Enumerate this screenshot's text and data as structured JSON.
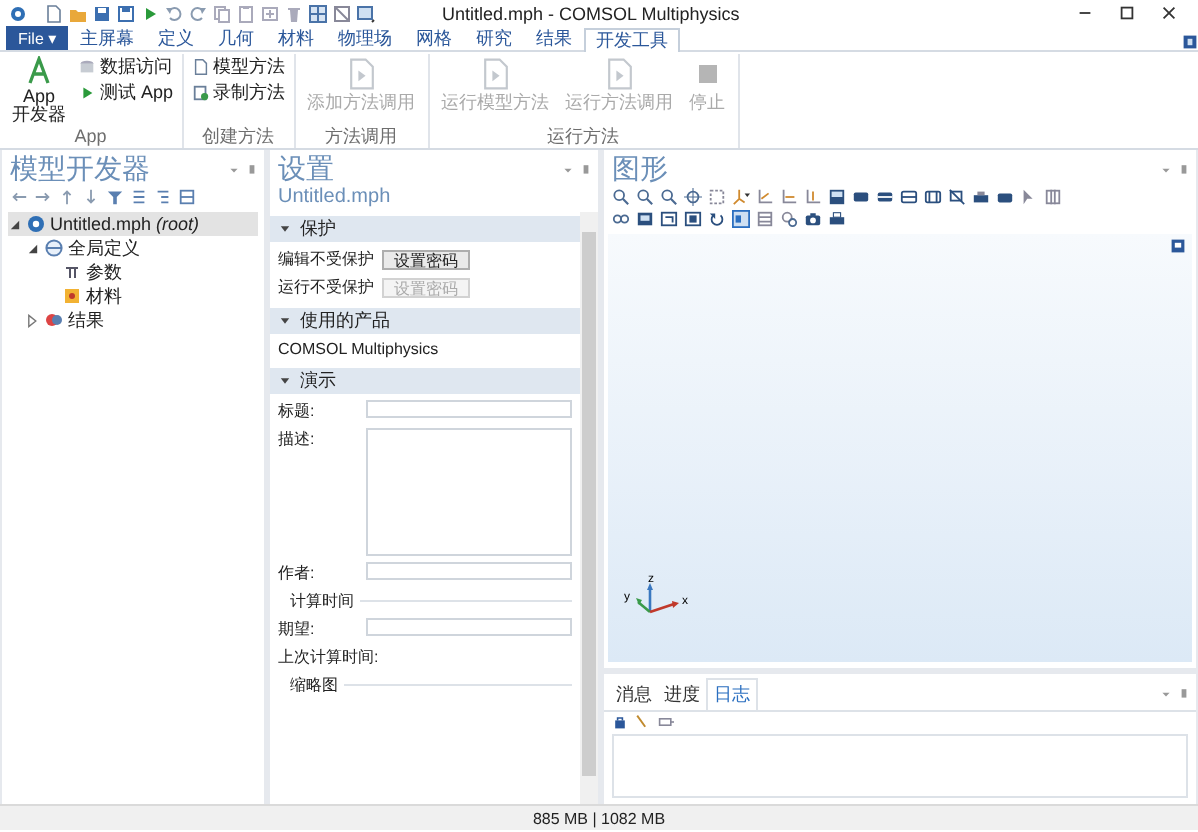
{
  "window": {
    "title": "Untitled.mph - COMSOL Multiphysics"
  },
  "ribbon_tabs": [
    {
      "label": "File ▾",
      "kind": "file",
      "selected": false
    },
    {
      "label": "主屏幕",
      "kind": "tab",
      "selected": false
    },
    {
      "label": "定义",
      "kind": "tab",
      "selected": false
    },
    {
      "label": "几何",
      "kind": "tab",
      "selected": false
    },
    {
      "label": "材料",
      "kind": "tab",
      "selected": false
    },
    {
      "label": "物理场",
      "kind": "tab",
      "selected": false
    },
    {
      "label": "网格",
      "kind": "tab",
      "selected": false
    },
    {
      "label": "研究",
      "kind": "tab",
      "selected": false
    },
    {
      "label": "结果",
      "kind": "tab",
      "selected": false
    },
    {
      "label": "开发工具",
      "kind": "tab",
      "selected": true
    }
  ],
  "ribbon_groups": [
    {
      "label": "App",
      "items": [
        {
          "kind": "large",
          "lines": [
            "App",
            "开发器"
          ],
          "disabled": false
        },
        {
          "kind": "small",
          "label": "数据访问",
          "disabled": false
        },
        {
          "kind": "small",
          "label": "测试 App",
          "disabled": false
        }
      ]
    },
    {
      "label": "创建方法",
      "items": [
        {
          "kind": "small",
          "label": "模型方法",
          "disabled": false
        },
        {
          "kind": "small",
          "label": "录制方法",
          "disabled": false
        }
      ]
    },
    {
      "label": "方法调用",
      "items": [
        {
          "kind": "large",
          "lines": [
            "添加方法调用"
          ],
          "disabled": true
        }
      ]
    },
    {
      "label": "运行方法",
      "items": [
        {
          "kind": "large",
          "lines": [
            "运行模型方法"
          ],
          "disabled": true
        },
        {
          "kind": "large",
          "lines": [
            "运行方法调用"
          ],
          "disabled": true
        },
        {
          "kind": "large",
          "lines": [
            "停止"
          ],
          "disabled": true
        }
      ]
    }
  ],
  "model_builder": {
    "title": "模型开发器",
    "tree": [
      {
        "label": "Untitled.mph *(root)*",
        "expanded": true,
        "selected": true,
        "children": [
          {
            "label": "全局定义",
            "expanded": true,
            "selected": false,
            "children": [
              {
                "label": "参数",
                "selected": false
              },
              {
                "label": "材料",
                "selected": false
              }
            ]
          },
          {
            "label": "结果",
            "expanded": false,
            "selected": false
          }
        ]
      }
    ]
  },
  "settings": {
    "title": "设置",
    "subtitle": "Untitled.mph",
    "sections": [
      {
        "title": "保护",
        "expanded": true,
        "rows": [
          {
            "kind": "password",
            "label": "编辑不受保护",
            "button": "设置密码",
            "disabled": false
          },
          {
            "kind": "password",
            "label": "运行不受保护",
            "button": "设置密码",
            "disabled": true
          }
        ]
      },
      {
        "title": "使用的产品",
        "expanded": true,
        "rows": [
          {
            "kind": "text",
            "text": "COMSOL Multiphysics"
          }
        ]
      },
      {
        "title": "演示",
        "expanded": true,
        "rows": [
          {
            "kind": "input",
            "label": "标题:"
          },
          {
            "kind": "textarea",
            "label": "描述:"
          },
          {
            "kind": "input",
            "label": "作者:"
          },
          {
            "kind": "group",
            "label": "计算时间"
          },
          {
            "kind": "input",
            "label": "期望:"
          },
          {
            "kind": "text",
            "text": "上次计算时间:"
          },
          {
            "kind": "group",
            "label": "缩略图"
          }
        ]
      }
    ]
  },
  "graphics": {
    "title": "图形",
    "triad": {
      "x": "x",
      "y": "y",
      "z": "z"
    }
  },
  "log": {
    "tabs": [
      {
        "label": "消息",
        "selected": false
      },
      {
        "label": "进度",
        "selected": false
      },
      {
        "label": "日志",
        "selected": true
      }
    ]
  },
  "status_bar": {
    "memory": "885 MB | 1082 MB"
  }
}
